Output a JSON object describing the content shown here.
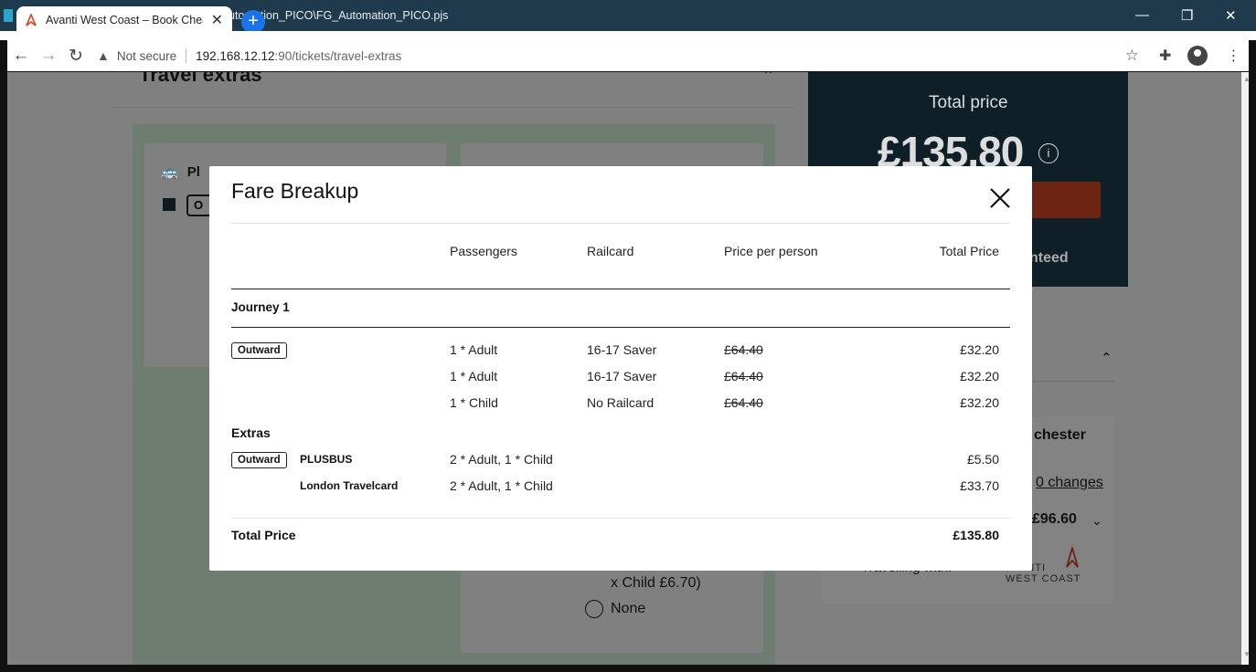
{
  "browser": {
    "tab_title": "Avanti West Coast – Book Cheap",
    "bg_window_title": "utomation_PICO\\FG_Automation_PICO.pjs",
    "security_label": "Not secure",
    "url_host": "192.168.12.12",
    "url_path": ":90/tickets/travel-extras",
    "icons": [
      "back-arrow-icon",
      "forward-arrow-icon",
      "reload-icon",
      "warning-icon",
      "star-icon",
      "extensions-icon",
      "profile-icon",
      "menu-icon",
      "new-tab-icon",
      "close-icon"
    ]
  },
  "page": {
    "section_heading": "Travel extras",
    "card_title_partial": "Pl",
    "card_option_partial": "O",
    "child_price_text": "x Child £6.70)",
    "none_option": "None",
    "total_price_label": "Total price",
    "total_price_value": "£135.80",
    "guaranteed_partial": "nteed",
    "destination_partial": "chester",
    "changes_link": "0 changes",
    "price_partial": "£96.60",
    "travelling_with": "Travelling with:",
    "operator_line1": "AVANTI",
    "operator_line2": "WEST COAST"
  },
  "modal": {
    "title": "Fare Breakup",
    "columns": {
      "passengers": "Passengers",
      "railcard": "Railcard",
      "price_per_person": "Price per person",
      "total_price": "Total Price"
    },
    "journey_label": "Journey 1",
    "outward_label": "Outward",
    "fares": [
      {
        "passengers": "1 * Adult",
        "railcard": "16-17 Saver",
        "price_per_person": "£64.40",
        "total": "£32.20"
      },
      {
        "passengers": "1 * Adult",
        "railcard": "16-17 Saver",
        "price_per_person": "£64.40",
        "total": "£32.20"
      },
      {
        "passengers": "1 * Child",
        "railcard": "No Railcard",
        "price_per_person": "£64.40",
        "total": "£32.20"
      }
    ],
    "extras_label": "Extras",
    "extras": [
      {
        "name": "PLUSBUS",
        "passengers": "2 * Adult, 1 * Child",
        "total": "£5.50"
      },
      {
        "name": "London Travelcard",
        "passengers": "2 * Adult, 1 * Child",
        "total": "£33.70"
      }
    ],
    "total_label": "Total Price",
    "total_value": "£135.80"
  },
  "colors": {
    "brand_red": "#e03c1f",
    "header_dark": "#0e1f28",
    "link_blue": "#1a73e8"
  }
}
